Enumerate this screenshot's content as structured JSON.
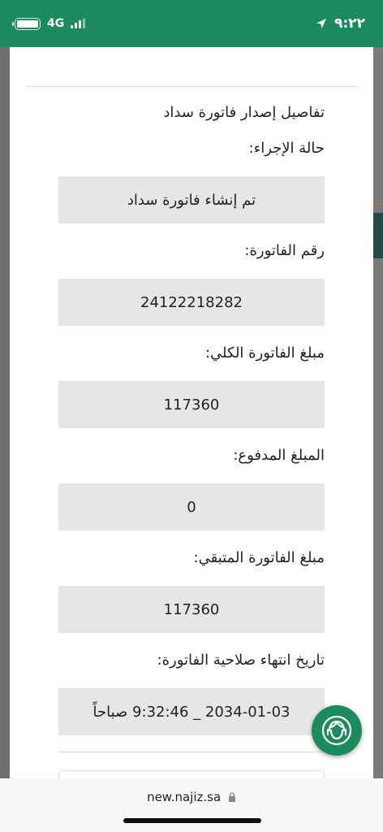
{
  "status_bar": {
    "time": "٩:٢٢",
    "network": "4G"
  },
  "section_title": "تفاصيل إصدار فاتورة سداد",
  "fields": [
    {
      "label": "حالة الإجراء:",
      "value": "تم إنشاء فاتورة سداد"
    },
    {
      "label": "رقم الفاتورة:",
      "value": "24122218282"
    },
    {
      "label": "مبلغ الفاتورة الكلي:",
      "value": "117360"
    },
    {
      "label": "المبلغ المدفوع:",
      "value": "0"
    },
    {
      "label": "مبلغ الفاتورة المتبقي:",
      "value": "117360"
    },
    {
      "label": "تاريخ انتهاء صلاحية الفاتورة:",
      "value": "2034-01-03 _ 9:32:46 صباحاً"
    }
  ],
  "browser": {
    "url": "new.najiz.sa"
  },
  "colors": {
    "brand_green": "#1b8a5e",
    "field_bg": "#e6e6e6"
  }
}
